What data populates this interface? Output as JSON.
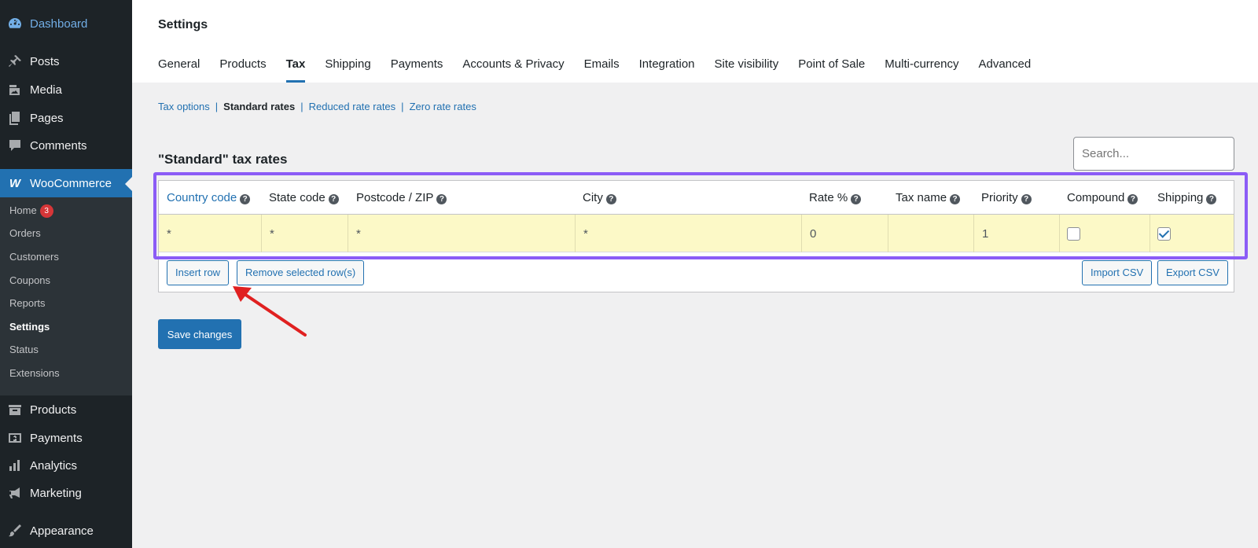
{
  "sidebar": {
    "items": [
      {
        "label": "Dashboard",
        "icon": "dashboard-icon"
      },
      {
        "label": "Posts",
        "icon": "pin-icon"
      },
      {
        "label": "Media",
        "icon": "media-icon"
      },
      {
        "label": "Pages",
        "icon": "pages-icon"
      },
      {
        "label": "Comments",
        "icon": "comment-icon"
      },
      {
        "label": "WooCommerce",
        "icon": "woocommerce-icon"
      },
      {
        "label": "Products",
        "icon": "archive-icon"
      },
      {
        "label": "Payments",
        "icon": "payments-icon"
      },
      {
        "label": "Analytics",
        "icon": "bar-chart-icon"
      },
      {
        "label": "Marketing",
        "icon": "megaphone-icon"
      },
      {
        "label": "Appearance",
        "icon": "brush-icon"
      }
    ],
    "submenu": [
      {
        "label": "Home",
        "badge": "3"
      },
      {
        "label": "Orders"
      },
      {
        "label": "Customers"
      },
      {
        "label": "Coupons"
      },
      {
        "label": "Reports"
      },
      {
        "label": "Settings"
      },
      {
        "label": "Status"
      },
      {
        "label": "Extensions"
      }
    ]
  },
  "header": {
    "title": "Settings",
    "tabs": [
      "General",
      "Products",
      "Tax",
      "Shipping",
      "Payments",
      "Accounts & Privacy",
      "Emails",
      "Integration",
      "Site visibility",
      "Point of Sale",
      "Multi-currency",
      "Advanced"
    ],
    "current_tab": "Tax"
  },
  "subnav": {
    "links": [
      "Tax options",
      "Standard rates",
      "Reduced rate rates",
      "Zero rate rates"
    ],
    "current": "Standard rates"
  },
  "section_title": "\"Standard\" tax rates",
  "search": {
    "placeholder": "Search..."
  },
  "table": {
    "columns": [
      "Country code",
      "State code",
      "Postcode / ZIP",
      "City",
      "Rate %",
      "Tax name",
      "Priority",
      "Compound",
      "Shipping"
    ],
    "row": {
      "country": "*",
      "state": "*",
      "postcode": "*",
      "city": "*",
      "rate": "0",
      "tax_name": "",
      "priority": "1",
      "compound": false,
      "shipping": true
    }
  },
  "buttons": {
    "insert_row": "Insert row",
    "remove_rows": "Remove selected row(s)",
    "import_csv": "Import CSV",
    "export_csv": "Export CSV",
    "save": "Save changes"
  },
  "colors": {
    "highlight": "#8b5cf6",
    "arrow": "#e02020",
    "accent": "#2271b1"
  }
}
